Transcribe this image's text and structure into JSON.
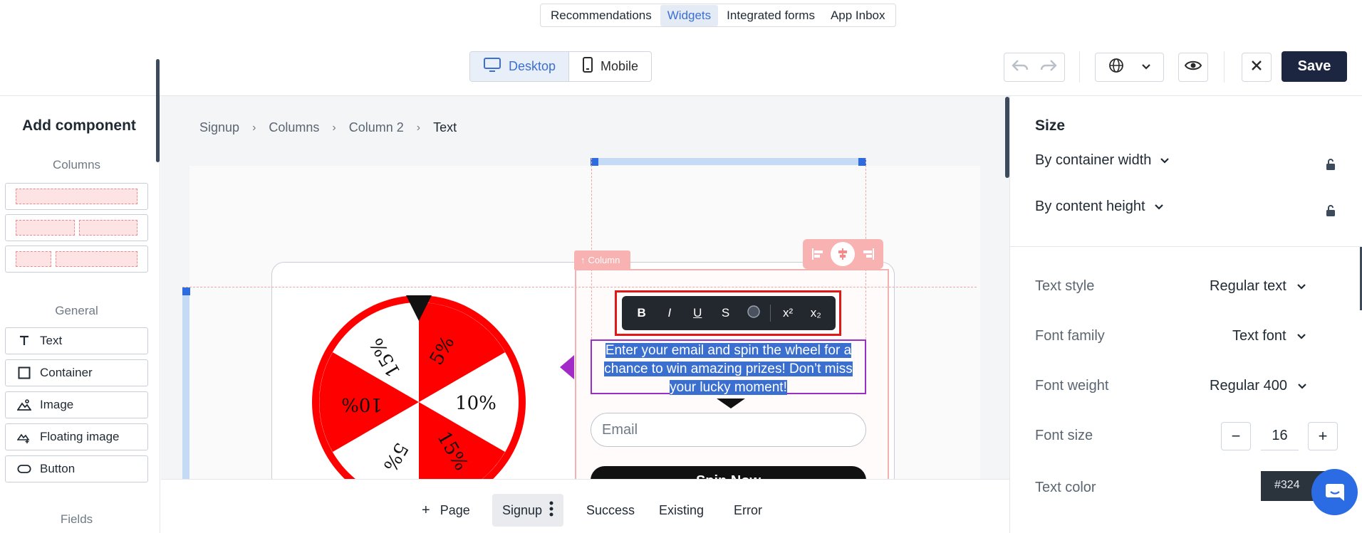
{
  "topnav": {
    "tabs": [
      {
        "label": "Recommendations"
      },
      {
        "label": "Widgets"
      },
      {
        "label": "Integrated forms"
      },
      {
        "label": "App Inbox"
      }
    ]
  },
  "toolbar": {
    "desktop_label": "Desktop",
    "mobile_label": "Mobile",
    "save_label": "Save"
  },
  "left_panel": {
    "title": "Add component",
    "columns_section": "Columns",
    "general_section": "General",
    "fields_section": "Fields",
    "components": [
      {
        "label": "Text"
      },
      {
        "label": "Container"
      },
      {
        "label": "Image"
      },
      {
        "label": "Floating image"
      },
      {
        "label": "Button"
      }
    ]
  },
  "breadcrumb": {
    "items": [
      "Signup",
      "Columns",
      "Column 2",
      "Text"
    ],
    "separator": "›"
  },
  "canvas": {
    "column_tag": "Column",
    "selected_text": "Enter your email and spin the wheel for a chance to win amazing prizes! Don’t miss your lucky moment!",
    "email_placeholder": "Email",
    "spin_button": "Spin Now",
    "wheel_labels": [
      "5%",
      "10%",
      "15%",
      "5%",
      "10%",
      "15%"
    ],
    "format_buttons": [
      "B",
      "I",
      "U",
      "S",
      "x²",
      "x₂"
    ]
  },
  "bottom_bar": {
    "add_page": "Page",
    "pages": [
      "Signup",
      "Success",
      "Existing",
      "Error"
    ]
  },
  "right_panel": {
    "size_heading": "Size",
    "width_mode": "By container width",
    "height_mode": "By content height",
    "text_style_label": "Text style",
    "text_style_value": "Regular text",
    "font_family_label": "Font family",
    "font_family_value": "Text font",
    "font_weight_label": "Font weight",
    "font_weight_value": "Regular 400",
    "font_size_label": "Font size",
    "font_size_value": "16",
    "text_color_label": "Text color",
    "text_color_value": "#324"
  },
  "colors": {
    "accent": "#3b6fd4",
    "save_bg": "#1c2640",
    "wheel_red": "#ff0000",
    "selection_purple": "#9b2fc4",
    "chat_blue": "#2b6be3"
  }
}
